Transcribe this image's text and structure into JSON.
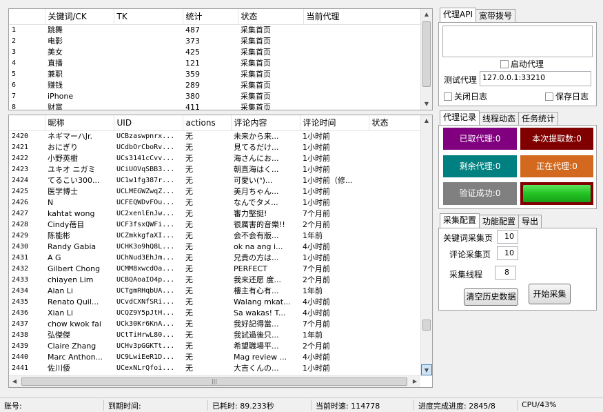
{
  "keywords_table": {
    "columns": [
      "",
      "关键词/CK",
      "TK",
      "统计",
      "状态",
      "当前代理"
    ],
    "rows": [
      [
        "1",
        "跳舞",
        "",
        "487",
        "采集首页",
        ""
      ],
      [
        "2",
        "电影",
        "",
        "373",
        "采集首页",
        ""
      ],
      [
        "3",
        "美女",
        "",
        "425",
        "采集首页",
        ""
      ],
      [
        "4",
        "直播",
        "",
        "121",
        "采集首页",
        ""
      ],
      [
        "5",
        "兼职",
        "",
        "359",
        "采集首页",
        ""
      ],
      [
        "6",
        "赚钱",
        "",
        "289",
        "采集首页",
        ""
      ],
      [
        "7",
        "iPhone",
        "",
        "380",
        "采集首页",
        ""
      ],
      [
        "8",
        "财富",
        "",
        "411",
        "采集首页",
        ""
      ]
    ]
  },
  "comments_table": {
    "columns": [
      "",
      "昵称",
      "UID",
      "actions",
      "评论内容",
      "评论时间",
      "状态"
    ],
    "rows": [
      [
        "2420",
        "ネギマーハJr.",
        "UCBzaswpnrx...",
        "无",
        "未来から来...",
        "1小时前",
        ""
      ],
      [
        "2421",
        "おにぎり",
        "UCdbOrCboRv...",
        "无",
        "見てるだけ...",
        "1小时前",
        ""
      ],
      [
        "2422",
        "小野英樹",
        "UCs3141cCvv...",
        "无",
        "海さんにお...",
        "1小时前",
        ""
      ],
      [
        "2423",
        "ユキオ ニガミ",
        "UCiUOVqSBB3...",
        "无",
        "朝直海はく...",
        "1小时前",
        ""
      ],
      [
        "2424",
        "てるこい300...",
        "UC1w1fg387r...",
        "无",
        "可愛い(ᐢ)...",
        "1小时前（修...",
        ""
      ],
      [
        "2425",
        "医学博士",
        "UCLMEGWZwqZ...",
        "无",
        "美月ちゃん...",
        "1小时前",
        ""
      ],
      [
        "2426",
        "N",
        "UCFEQWDvFOu...",
        "无",
        "なんでタメ...",
        "1小时前",
        ""
      ],
      [
        "2427",
        "kahtat wong",
        "UC2xenlEnJw...",
        "无",
        "審力堅挺!",
        "7个月前",
        ""
      ],
      [
        "2428",
        "Cindy蓓目",
        "UCF3fsxQWFi...",
        "无",
        "很厲害的音樂!!",
        "2个月前",
        ""
      ],
      [
        "2429",
        "陈能彬",
        "UCZmkkgfaXI...",
        "无",
        "会不会有版...",
        "1年前",
        ""
      ],
      [
        "2430",
        "Randy Gabia",
        "UCHK3o9hQ8L...",
        "无",
        "ok na ang i...",
        "4小时前",
        ""
      ],
      [
        "2431",
        "A G",
        "UChNud3EhJm...",
        "无",
        "兄貴の方は...",
        "1小时前",
        ""
      ],
      [
        "2432",
        "Gilbert Chong",
        "UCMM8xwcdOa...",
        "无",
        "PERFECT",
        "7个月前",
        ""
      ],
      [
        "2433",
        "chiayen Lim",
        "UCBQAoaIO4p...",
        "无",
        "我来还愿 度...",
        "2个月前",
        ""
      ],
      [
        "2434",
        "Alan Li",
        "UCTgmRHqbUA...",
        "无",
        "樓主有心有...",
        "1年前",
        ""
      ],
      [
        "2435",
        "Renato Quil...",
        "UCvdCXNfSRi...",
        "无",
        "Walang mkat...",
        "4小时前",
        ""
      ],
      [
        "2436",
        "Xian Li",
        "UCQZ9Y5pJtH...",
        "无",
        "Sa wakas! T...",
        "4小时前",
        ""
      ],
      [
        "2437",
        "chow kwok fai",
        "UCk30Kr6KnA...",
        "无",
        "我好記得當...",
        "7个月前",
        ""
      ],
      [
        "2438",
        "弘傑傑",
        "UCtTiHrwL80...",
        "无",
        "我試過後只...",
        "1年前",
        ""
      ],
      [
        "2439",
        "Claire Zhang",
        "UCHv3pGGKTt...",
        "无",
        "希望職場平...",
        "2个月前",
        ""
      ],
      [
        "2440",
        "Marc Anthon...",
        "UC9LwiEeR1D...",
        "无",
        "Mag review ...",
        "4小时前",
        ""
      ],
      [
        "2441",
        "佐川倭",
        "UCexNLrQfoi...",
        "无",
        "大吉くんの...",
        "1小时前",
        ""
      ]
    ]
  },
  "proxy_panel": {
    "tabs": [
      "代理API",
      "宽带拨号"
    ],
    "enable_proxy_label": "启动代理",
    "test_proxy_label": "测试代理",
    "test_proxy_value": "127.0.0.1:33210",
    "close_log_label": "关闭日志",
    "save_log_label": "保存日志"
  },
  "record_panel": {
    "tabs": [
      "代理记录",
      "线程动态",
      "任务统计"
    ],
    "tiles": [
      {
        "label": "已取代理:0",
        "color": "#800080"
      },
      {
        "label": "本次提取数:0",
        "color": "#800000"
      },
      {
        "label": "剩余代理:0",
        "color": "#008080"
      },
      {
        "label": "正在代理:0",
        "color": "#d2691e"
      },
      {
        "label": "验证成功:0",
        "color": "#808080"
      }
    ],
    "progress_color": "#22c322"
  },
  "config_panel": {
    "tabs": [
      "采集配置",
      "功能配置",
      "导出"
    ],
    "keyword_pages_label": "关键词采集页",
    "keyword_pages_value": "10",
    "comment_pages_label": "评论采集页",
    "comment_pages_value": "10",
    "threads_label": "采集线程",
    "threads_value": "8",
    "clear_button": "清空历史数据",
    "start_button": "开始采集"
  },
  "status_bar": {
    "account": "账号:",
    "expiry": "到期时间:",
    "elapsed": "已耗时: 89.233秒",
    "speed": "当前时速: 114778",
    "progress": "进度完成进度: 2845/8",
    "cpu": "CPU/43%"
  }
}
